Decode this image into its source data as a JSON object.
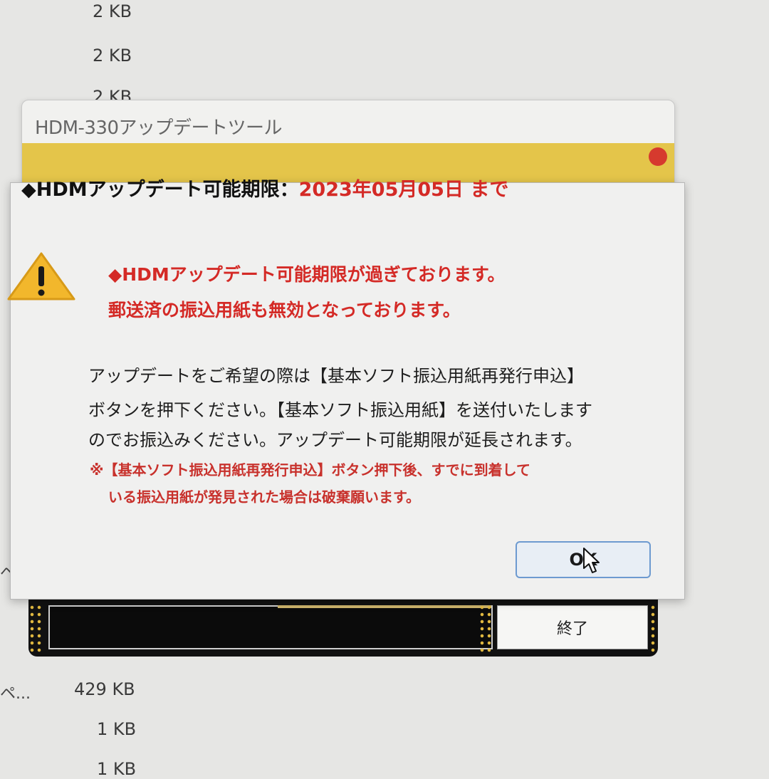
{
  "file_list": {
    "sizes_top": [
      "2 KB",
      "2 KB",
      "2 KB"
    ],
    "sizes_bottom": [
      "429 KB",
      "1 KB",
      "1 KB"
    ],
    "truncated_names": [
      "ペ...",
      "ペ..."
    ]
  },
  "tool_window": {
    "title": "HDM-330アップデートツール",
    "exit_label": "終了"
  },
  "deadline": {
    "label": "◆HDMアップデート可能期限：",
    "date": "2023年05月05日 まで"
  },
  "dialog": {
    "warning_line1": "◆HDMアップデート可能期限が過ぎております。",
    "warning_line2": "郵送済の振込用紙も無効となっております。",
    "body_line1": "アップデートをご希望の際は【基本ソフト振込用紙再発行申込】",
    "body_line2": "ボタンを押下ください。【基本ソフト振込用紙】を送付いたします",
    "body_line3": "のでお振込みください。アップデート可能期限が延長されます。",
    "note_line1": "※【基本ソフト振込用紙再発行申込】ボタン押下後、すでに到着して",
    "note_line2": "いる振込用紙が発見された場合は破棄願います。",
    "ok_label": "OK"
  },
  "colors": {
    "warning_red": "#d42a26",
    "tool_bar_yellow": "#e4c54a",
    "ok_border_blue": "#6d9ad0"
  },
  "icons": [
    "warning-icon",
    "mouse-cursor-icon"
  ]
}
